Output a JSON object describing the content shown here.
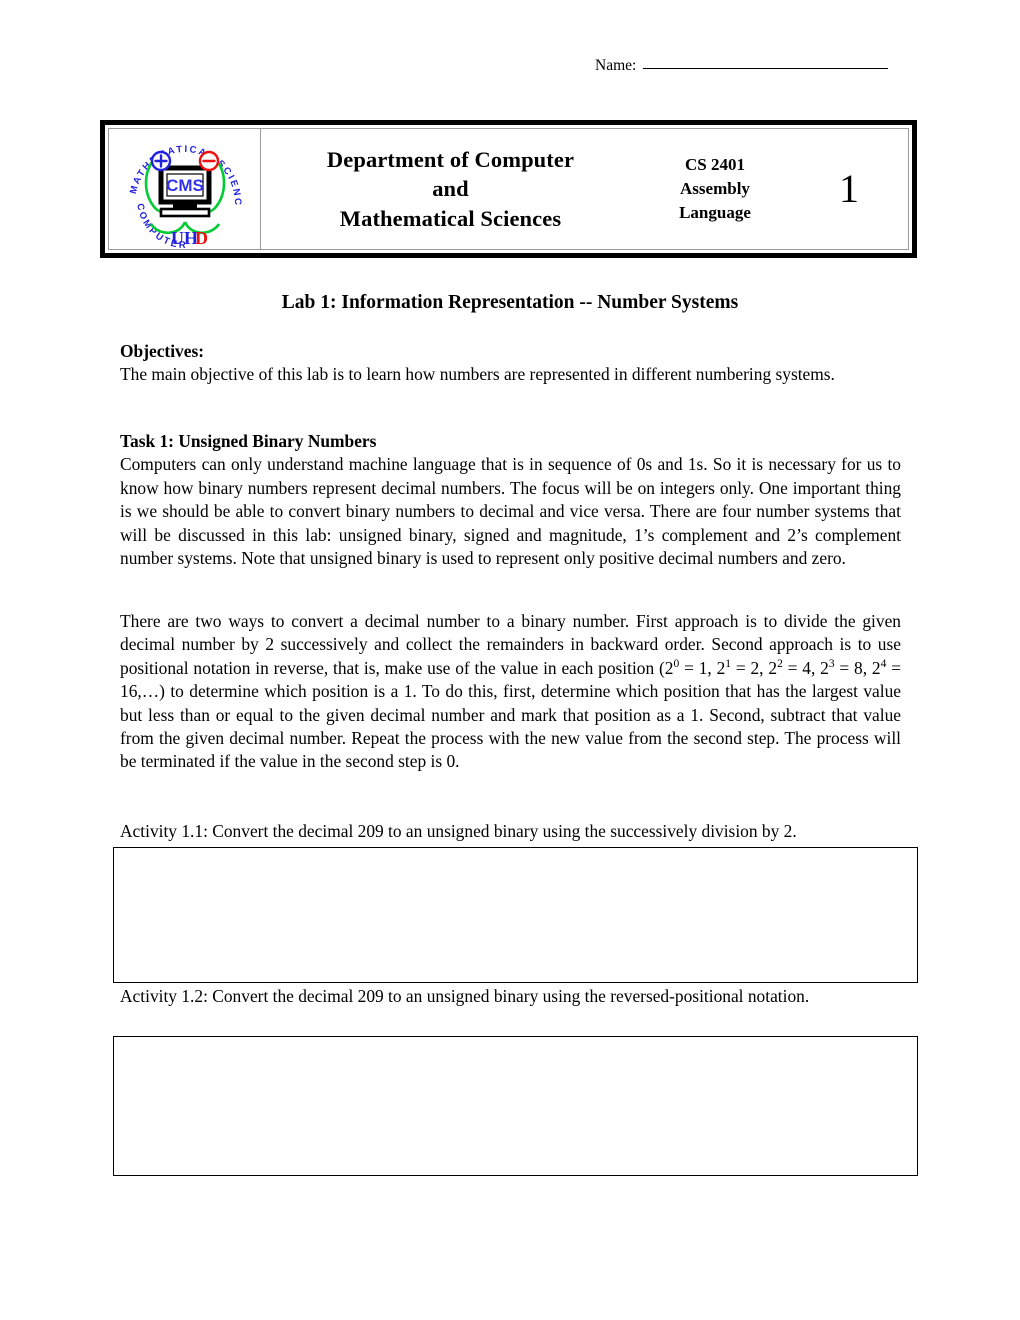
{
  "name_field": {
    "label": "Name:",
    "value": ""
  },
  "header": {
    "logo": {
      "alt": "cms-uhd-logo",
      "monitor_text": "CMS",
      "ring_text_top": "MATHEMATICAL SCIENCES",
      "ring_text_left": "COMPUTER",
      "plus_symbol": "+",
      "minus_symbol": "−",
      "university_abbrev_blue": "UH",
      "university_abbrev_red": "D",
      "colors": {
        "blue": "#2222dd",
        "red": "#ee1111",
        "green": "#00cc33",
        "black": "#000000"
      }
    },
    "department_lines": [
      "Department of Computer",
      "and",
      "Mathematical Sciences"
    ],
    "course_lines": [
      "CS 2401",
      "Assembly",
      "Language"
    ],
    "lab_number": "1"
  },
  "title": "Lab 1: Information Representation -- Number Systems",
  "sections": {
    "objectives": {
      "heading": "Objectives:",
      "body": "The main objective of this lab is to learn how numbers are represented in different numbering systems."
    },
    "task1": {
      "heading": "Task 1: Unsigned Binary Numbers",
      "body": "Computers can only understand machine language that is in sequence of 0s and 1s. So it is necessary for us to know how binary numbers represent decimal numbers. The focus will be on integers only. One important thing is we should be able to convert binary numbers to decimal and vice versa. There are four number systems that will be discussed in this lab: unsigned binary, signed and magnitude, 1’s complement and 2’s complement number systems. Note that unsigned binary is used to represent only positive decimal numbers and zero."
    },
    "conversion_methods": {
      "part1": "There are two ways to convert a decimal number to a binary number. First approach is to divide the given decimal number by 2 successively and collect the remainders in backward order. Second approach is to use positional notation in reverse, that is, make use of the value in each position (2",
      "powers": [
        {
          "exp": "0",
          "eq": " = 1, 2"
        },
        {
          "exp": "1",
          "eq": " = 2, 2"
        },
        {
          "exp": "2",
          "eq": " = 4, 2"
        },
        {
          "exp": "3",
          "eq": " = 8, 2"
        },
        {
          "exp": "4",
          "eq": " = 16,…)"
        }
      ],
      "part2": " to determine which position is a 1. To do this, first, determine which position that has the largest value but less than or equal to the given decimal number and mark that position as a 1. Second, subtract that value from the given decimal number. Repeat the process with the new value from the second step. The process will be terminated if the value in the second step is 0."
    }
  },
  "activities": [
    {
      "label": "Activity 1.1: Convert the decimal 209 to an unsigned binary using the successively division by 2.",
      "answer": ""
    },
    {
      "label": "Activity 1.2: Convert the decimal 209 to an unsigned binary using the reversed-positional notation.",
      "answer": ""
    }
  ]
}
